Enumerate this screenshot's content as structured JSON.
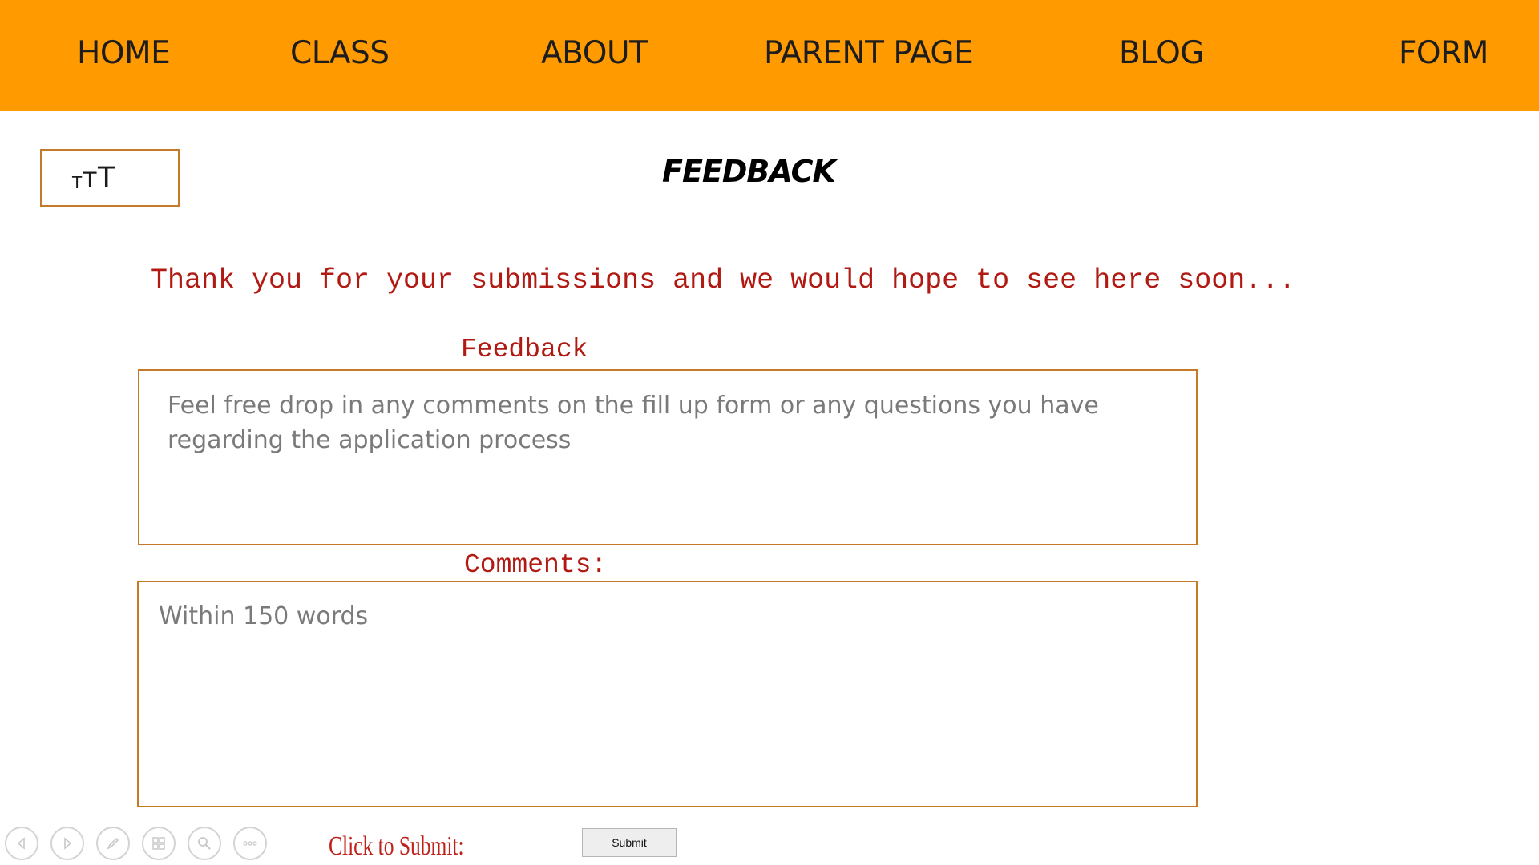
{
  "nav": {
    "items": [
      {
        "label": "HOME"
      },
      {
        "label": "CLASS"
      },
      {
        "label": "ABOUT"
      },
      {
        "label": "PARENT PAGE"
      },
      {
        "label": "BLOG"
      },
      {
        "label": "FORM"
      }
    ],
    "background": "#ff9a00"
  },
  "font_size_control": {
    "small": "T",
    "medium": "T",
    "large": "T"
  },
  "page_title": "FEEDBACK",
  "thanks_message": "Thank you for your submissions and we would hope to see here soon...",
  "feedback": {
    "label": "Feedback",
    "placeholder_line1": "Feel free drop in any comments on the fill up form or any questions you have",
    "placeholder_line2": "regarding the application process"
  },
  "comments": {
    "label": "Comments:",
    "placeholder": "Within 150 words"
  },
  "submit": {
    "prompt": "Click to Submit:",
    "button_label": "Submit"
  },
  "presentation_toolbar": {
    "icons": [
      "previous-icon",
      "next-icon",
      "pen-icon",
      "slides-icon",
      "zoom-icon",
      "more-icon"
    ]
  },
  "colors": {
    "accent": "#ff9a00",
    "label_red": "#b01a12",
    "border": "#c57a2a"
  }
}
